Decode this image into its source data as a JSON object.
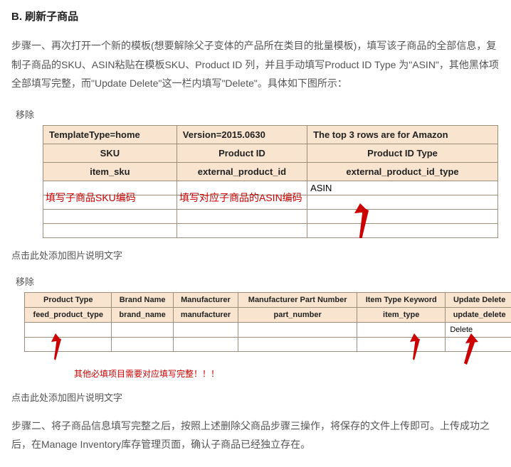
{
  "title": "B. 刷新子商品",
  "step1_paragraph": "步骤一、再次打开一个新的模板(想要解除父子变体的产品所在类目的批量模板)，填写该子商品的全部信息，复制子商品的SKU、ASIN粘贴在模板SKU、Product ID 列，并且手动填写Product ID Type 为\"ASIN\"，其他黑体项全部填写完整，而\"Update Delete\"这一栏内填写\"Delete\"。具体如下图所示：",
  "remove_label": "移除",
  "table1": {
    "row1": {
      "c1": "TemplateType=home",
      "c2": "Version=2015.0630",
      "c3": "The top 3 rows are for Amazon"
    },
    "row2": {
      "c1": "SKU",
      "c2": "Product ID",
      "c3": "Product ID Type"
    },
    "row3": {
      "c1": "item_sku",
      "c2": "external_product_id",
      "c3": "external_product_id_type"
    },
    "overlay1": "填写子商品SKU编码",
    "overlay2": "填写对应子商品的ASIN编码",
    "asin_value": "ASIN"
  },
  "caption_placeholder": "点击此处添加图片说明文字",
  "table2": {
    "row1": {
      "c1": "Product Type",
      "c2": "Brand Name",
      "c3": "Manufacturer",
      "c4": "Manufacturer Part Number",
      "c5": "Item Type Keyword",
      "c6": "Update Delete"
    },
    "row2": {
      "c1": "feed_product_type",
      "c2": "brand_name",
      "c3": "manufacturer",
      "c4": "part_number",
      "c5": "item_type",
      "c6": "update_delete"
    },
    "delete_value": "Delete",
    "footnote": "其他必填项目需要对应填写完整！！！"
  },
  "step2_paragraph": "步骤二、将子商品信息填写完整之后，按照上述删除父商品步骤三操作，将保存的文件上传即可。上传成功之后，在Manage Inventory库存管理页面，确认子商品已经独立存在。"
}
